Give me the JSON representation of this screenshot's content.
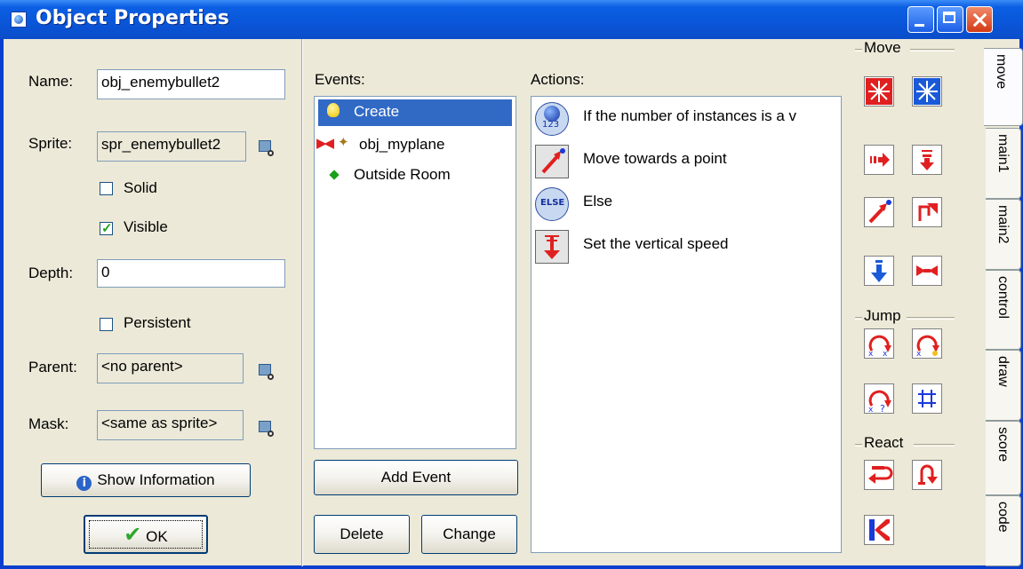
{
  "window": {
    "title": "Object Properties"
  },
  "left_panel": {
    "name_label": "Name:",
    "name_value": "obj_enemybullet2",
    "sprite_label": "Sprite:",
    "sprite_value": "spr_enemybullet2",
    "solid_label": "Solid",
    "solid_checked": false,
    "visible_label": "Visible",
    "visible_checked": true,
    "depth_label": "Depth:",
    "depth_value": "0",
    "persistent_label": "Persistent",
    "persistent_checked": false,
    "parent_label": "Parent:",
    "parent_value": "<no parent>",
    "mask_label": "Mask:",
    "mask_value": "<same as sprite>",
    "show_info_label": "Show Information",
    "ok_label": "OK"
  },
  "events": {
    "label": "Events:",
    "items": [
      {
        "label": "Create",
        "icon": "lightbulb-icon",
        "selected": true
      },
      {
        "label": "obj_myplane",
        "icon": "collision-icon",
        "selected": false
      },
      {
        "label": "Outside Room",
        "icon": "green-diamond-icon",
        "selected": false
      }
    ],
    "add_event_label": "Add Event",
    "delete_label": "Delete",
    "change_label": "Change"
  },
  "actions": {
    "label": "Actions:",
    "items": [
      {
        "label": "If the number of instances is a v",
        "icon": "test-instance-count-icon"
      },
      {
        "label": "Move towards a point",
        "icon": "move-towards-point-icon"
      },
      {
        "label": "Else",
        "icon": "else-icon"
      },
      {
        "label": "Set the vertical speed",
        "icon": "vertical-speed-icon"
      }
    ]
  },
  "palette": {
    "groups": {
      "move": "Move",
      "jump": "Jump",
      "react": "React"
    }
  },
  "tabs": [
    "move",
    "main1",
    "main2",
    "control",
    "draw",
    "score",
    "code"
  ],
  "active_tab": "move",
  "colors": {
    "titlebar": "#0a55d8",
    "selection": "#316ac5",
    "window_bg": "#ece9d8",
    "icon_red": "#e02020",
    "icon_blue": "#1a5ad8"
  }
}
